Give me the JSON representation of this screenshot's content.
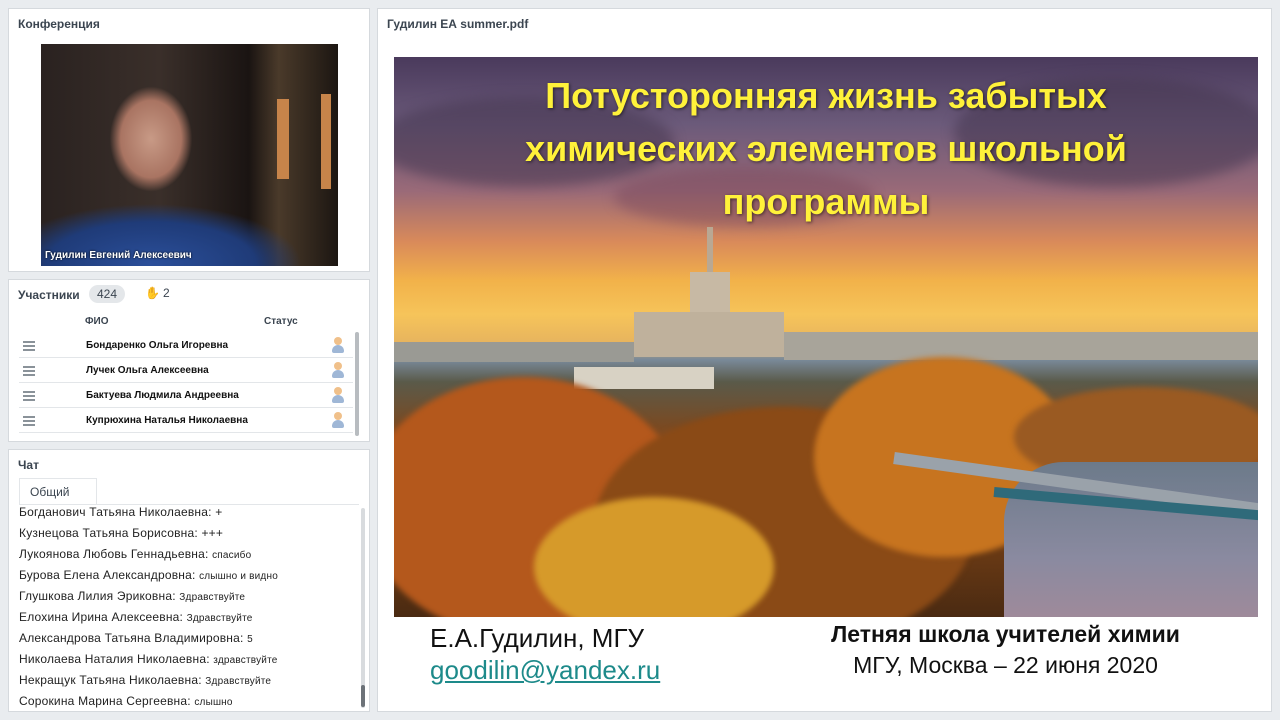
{
  "conference": {
    "title": "Конференция",
    "speaker_name": "Гудилин Евгений  Алексеевич"
  },
  "participants": {
    "title": "Участники",
    "count": "424",
    "raised_hands": "2",
    "columns": {
      "name": "ФИО",
      "status": "Статус"
    },
    "rows": [
      {
        "name": "Бондаренко Ольга Игоревна"
      },
      {
        "name": "Лучек Ольга  Алексеевна"
      },
      {
        "name": "Бактуева Людмила  Андреевна"
      },
      {
        "name": "Купрюхина Наталья Николаевна"
      }
    ]
  },
  "chat": {
    "title": "Чат",
    "tab": "Общий",
    "messages": [
      {
        "author": "Богданович Татьяна Николаевна:",
        "text": "+"
      },
      {
        "author": "Кузнецова Татьяна  Борисовна:",
        "text": "+++"
      },
      {
        "author": "Лукоянова Любовь Геннадьевна:",
        "text": "спасибо"
      },
      {
        "author": "Бурова  Елена  Александровна:",
        "text": "слышно и видно"
      },
      {
        "author": "Глушкова  Лилия  Эриковна:",
        "text": "Здравствуйте"
      },
      {
        "author": "Елохина Ирина Алексеевна:",
        "text": "Здравствуйте"
      },
      {
        "author": "Александрова Татьяна Владимировна:",
        "text": "5"
      },
      {
        "author": "Николаева Наталия Николаевна:",
        "text": "здравствуйте"
      },
      {
        "author": "Некращук Татьяна Николаевна:",
        "text": "Здравствуйте"
      },
      {
        "author": "Сорокина Марина Сергеевна:",
        "text": "слышно"
      }
    ]
  },
  "document": {
    "title": "Гудилин ЕА summer.pdf",
    "slide": {
      "title_line1": "Потусторонняя жизнь забытых",
      "title_line2": "химических элементов школьной",
      "title_line3": "программы",
      "author": "Е.А.Гудилин, МГУ",
      "email": "goodilin@yandex.ru",
      "event": "Летняя школа учителей химии",
      "place_date": "МГУ, Москва – 22 июня 2020"
    }
  },
  "colors": {
    "title_yellow": "#fff23a",
    "email_teal": "#1d8a8a",
    "panel_bg": "#ffffff",
    "page_bg": "#e9ecef"
  }
}
